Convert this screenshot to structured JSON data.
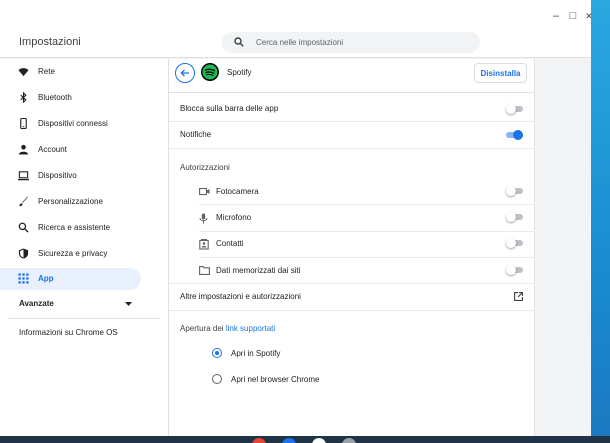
{
  "window": {
    "title": "Impostazioni",
    "controls": {
      "minimize": "–",
      "maximize": "□",
      "close": "✕"
    }
  },
  "search": {
    "placeholder": "Cerca nelle impostazioni"
  },
  "sidebar": {
    "items": [
      {
        "label": "Rete",
        "icon": "wifi-icon"
      },
      {
        "label": "Bluetooth",
        "icon": "bluetooth-icon"
      },
      {
        "label": "Dispositivi connessi",
        "icon": "phone-icon"
      },
      {
        "label": "Account",
        "icon": "person-icon"
      },
      {
        "label": "Dispositivo",
        "icon": "laptop-icon"
      },
      {
        "label": "Personalizzazione",
        "icon": "brush-icon"
      },
      {
        "label": "Ricerca e assistente",
        "icon": "search-icon"
      },
      {
        "label": "Sicurezza e privacy",
        "icon": "shield-icon"
      },
      {
        "label": "App",
        "icon": "apps-grid-icon",
        "active": true
      }
    ],
    "advanced": "Avanzate",
    "about": "Informazioni su Chrome OS"
  },
  "app": {
    "name": "Spotify",
    "uninstall_label": "Disinstalla",
    "pin_label": "Blocca sulla barra delle app",
    "pin_on": false,
    "notifications_label": "Notifiche",
    "notifications_on": true,
    "permissions_heading": "Autorizzazioni",
    "permissions": [
      {
        "label": "Fotocamera",
        "icon": "camera-icon",
        "on": false
      },
      {
        "label": "Microfono",
        "icon": "microphone-icon",
        "on": false
      },
      {
        "label": "Contatti",
        "icon": "contacts-icon",
        "on": false
      },
      {
        "label": "Dati memorizzati dai siti",
        "icon": "folder-icon",
        "on": false
      }
    ],
    "more_settings_label": "Altre impostazioni e autorizzazioni",
    "open_links_prefix": "Apertura dei ",
    "open_links_link": "link supportati",
    "open_options": [
      {
        "label": "Apri in Spotify",
        "selected": true
      },
      {
        "label": "Apri nel browser Chrome",
        "selected": false
      }
    ]
  },
  "colors": {
    "accent": "#1a73e8",
    "spotify_green": "#1db954"
  }
}
